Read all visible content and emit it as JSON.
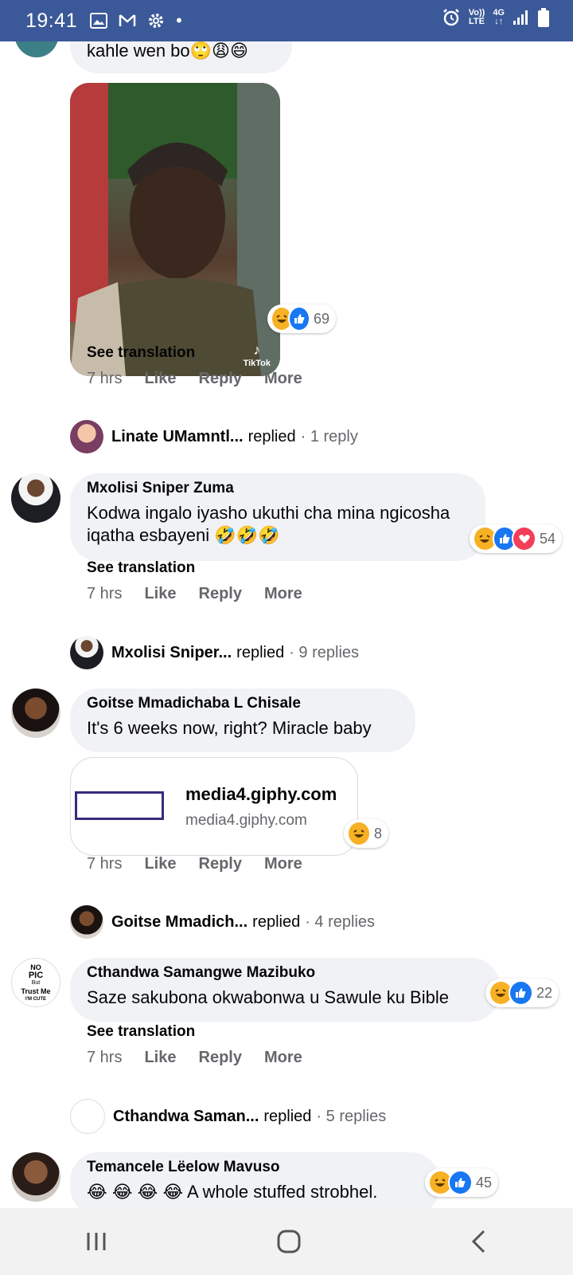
{
  "status": {
    "time": "19:41",
    "volte_top": "Vo))",
    "volte_bottom": "LTE",
    "net_top": "4G",
    "net_bottom": "↓↑"
  },
  "comments": [
    {
      "text_fragment": "kahle wen bo🙄😩😄",
      "image_caption": "TikTok",
      "reactions": {
        "icons": [
          "haha-icon",
          "like-icon"
        ],
        "count": "69"
      },
      "see_translation": "See translation",
      "time": "7 hrs",
      "like": "Like",
      "reply": "Reply",
      "more": "More",
      "replied": {
        "name": "Linate UMamntl...",
        "verb": "replied",
        "count": "· 1 reply"
      }
    },
    {
      "name": "Mxolisi Sniper Zuma",
      "text": "Kodwa ingalo iyasho ukuthi cha mina ngicosha iqatha esbayeni 🤣🤣🤣",
      "reactions": {
        "icons": [
          "haha-icon",
          "like-icon",
          "love-icon"
        ],
        "count": "54"
      },
      "see_translation": "See translation",
      "time": "7 hrs",
      "like": "Like",
      "reply": "Reply",
      "more": "More",
      "replied": {
        "name": "Mxolisi Sniper...",
        "verb": "replied",
        "count": "· 9 replies"
      }
    },
    {
      "name": "Goitse Mmadichaba L Chisale",
      "text": "It's 6 weeks now, right? Miracle baby",
      "link": {
        "title": "media4.giphy.com",
        "domain": "media4.giphy.com"
      },
      "reactions": {
        "icons": [
          "haha-icon"
        ],
        "count": "8"
      },
      "time": "7 hrs",
      "like": "Like",
      "reply": "Reply",
      "more": "More",
      "replied": {
        "name": "Goitse Mmadich...",
        "verb": "replied",
        "count": "· 4 replies"
      }
    },
    {
      "name": "Cthandwa Samangwe Mazibuko",
      "text": "Saze sakubona okwabonwa u Sawule ku Bible",
      "avatar_text": [
        "NO",
        "PIC",
        "But",
        "Trust Me",
        "I'M CUTE"
      ],
      "reactions": {
        "icons": [
          "haha-icon",
          "like-icon"
        ],
        "count": "22"
      },
      "see_translation": "See translation",
      "time": "7 hrs",
      "like": "Like",
      "reply": "Reply",
      "more": "More",
      "replied": {
        "name": "Cthandwa Saman...",
        "verb": "replied",
        "count": "· 5 replies"
      }
    },
    {
      "name": "Temancele Lëelow Mavuso",
      "text": "😂 😂 😂 😂 A whole stuffed strobhel.",
      "reactions": {
        "icons": [
          "haha-icon",
          "like-icon"
        ],
        "count": "45"
      }
    }
  ]
}
